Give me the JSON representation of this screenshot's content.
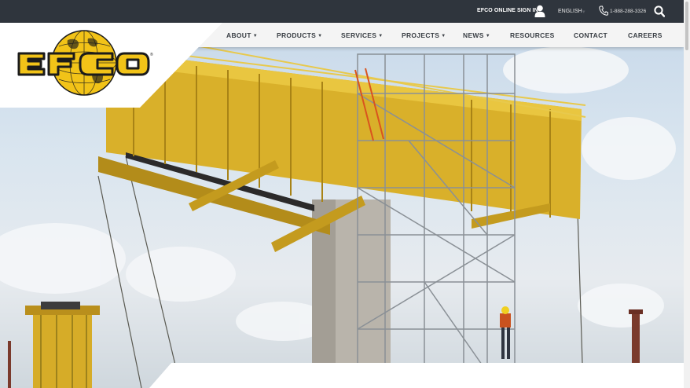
{
  "topbar": {
    "signin_label": "EFCO ONLINE SIGN IN",
    "language": "ENGLISH",
    "phone": "1-888-288-3326"
  },
  "nav": {
    "items": [
      {
        "label": "ABOUT",
        "dropdown": true
      },
      {
        "label": "PRODUCTS",
        "dropdown": true
      },
      {
        "label": "SERVICES",
        "dropdown": true
      },
      {
        "label": "PROJECTS",
        "dropdown": true
      },
      {
        "label": "NEWS",
        "dropdown": true
      },
      {
        "label": "RESOURCES",
        "dropdown": false
      },
      {
        "label": "CONTACT",
        "dropdown": false
      },
      {
        "label": "CAREERS",
        "dropdown": false
      }
    ]
  },
  "logo": {
    "text": "EFCO",
    "registered": "®"
  },
  "colors": {
    "topbar": "#2f353d",
    "brand_yellow": "#f2c318",
    "brand_black": "#1b1b1b",
    "nav_bg": "#f4f4f4",
    "nav_text": "#3a3f45"
  },
  "icons": [
    "user-icon",
    "phone-icon",
    "search-icon",
    "caret-down-icon"
  ]
}
